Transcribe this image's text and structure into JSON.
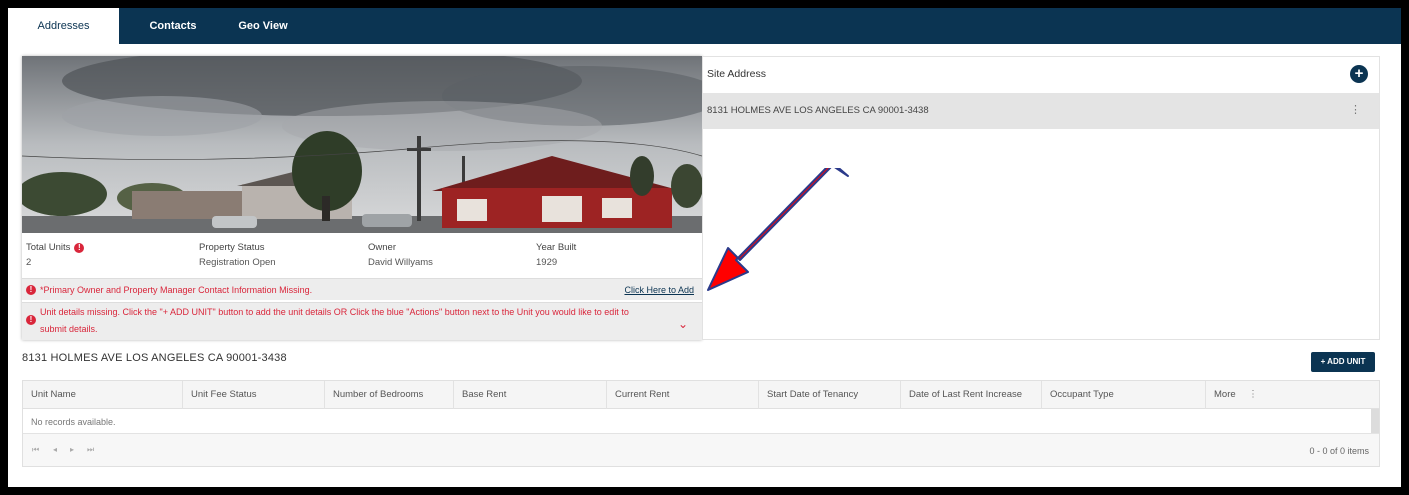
{
  "tabs": [
    {
      "label": "Addresses"
    },
    {
      "label": "Contacts"
    },
    {
      "label": "Geo View"
    }
  ],
  "property": {
    "total_units_label": "Total Units",
    "total_units_value": "2",
    "status_label": "Property Status",
    "status_value": "Registration Open",
    "owner_label": "Owner",
    "owner_value": "David Willyams",
    "year_built_label": "Year Built",
    "year_built_value": "1929",
    "alert1_text": "*Primary Owner and Property Manager Contact Information Missing.",
    "alert1_link": "Click Here to Add",
    "alert2_line1": "Unit details missing. Click the \"+ ADD UNIT\" button to add the unit details OR Click the blue \"Actions\" button next to the Unit you would like to edit to",
    "alert2_line2": "submit details."
  },
  "site": {
    "title": "Site Address",
    "address": "8131 HOLMES AVE LOS ANGELES CA 90001-3438"
  },
  "units": {
    "heading": "8131 HOLMES AVE LOS ANGELES CA 90001-3438",
    "add_button": "+ ADD UNIT",
    "columns": [
      "Unit Name",
      "Unit Fee Status",
      "Number of Bedrooms",
      "Base Rent",
      "Current Rent",
      "Start Date of Tenancy",
      "Date of Last Rent Increase",
      "Occupant Type",
      "More"
    ],
    "empty_text": "No records available.",
    "pager_info": "0 - 0 of 0 items"
  },
  "colors": {
    "navy": "#0b3452",
    "alert_red": "#d9263b",
    "arrow_red": "#ff0000"
  }
}
